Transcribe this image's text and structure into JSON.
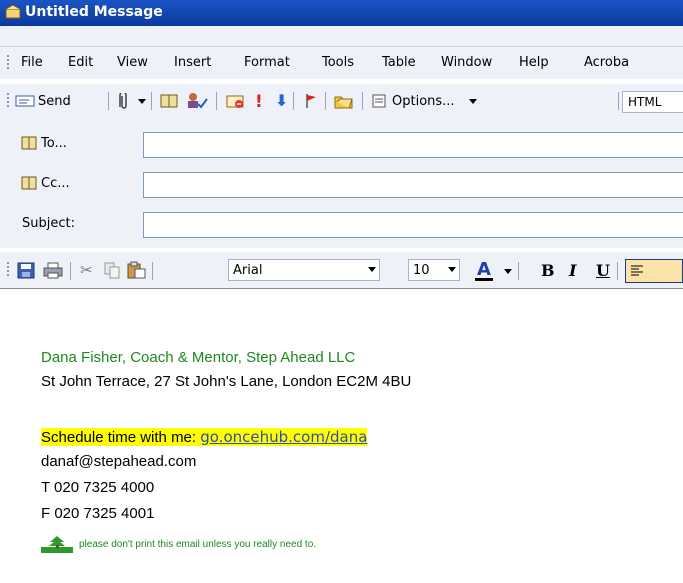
{
  "window": {
    "title": "Untitled Message"
  },
  "menu": [
    "File",
    "Edit",
    "View",
    "Insert",
    "Format",
    "Tools",
    "Table",
    "Window",
    "Help",
    "Acroba"
  ],
  "toolbar": {
    "send_label": "Send",
    "options_label": "Options...",
    "format_label": "HTML"
  },
  "header": {
    "to_label": "To...",
    "cc_label": "Cc...",
    "subject_label": "Subject:",
    "to_value": "",
    "cc_value": "",
    "subject_value": ""
  },
  "format_bar": {
    "font": "Arial",
    "size": "10"
  },
  "body": {
    "name_line": "Dana Fisher, Coach & Mentor, Step Ahead LLC",
    "address_line": "St John Terrace, 27 St John's Lane, London EC2M 4BU",
    "schedule_prefix": "Schedule time with me: ",
    "schedule_link": "go.oncehub.com/dana",
    "email": "danaf@stepahead.com",
    "phone": "T 020 7325 4000",
    "fax": "F 020 7325 4001",
    "eco_note": "please don't print this email unless you really need to."
  },
  "colors": {
    "title_bar": "#1c54c4",
    "signature_green": "#1c8a1c",
    "highlight": "#ffff00",
    "link": "#2f4fa8"
  }
}
